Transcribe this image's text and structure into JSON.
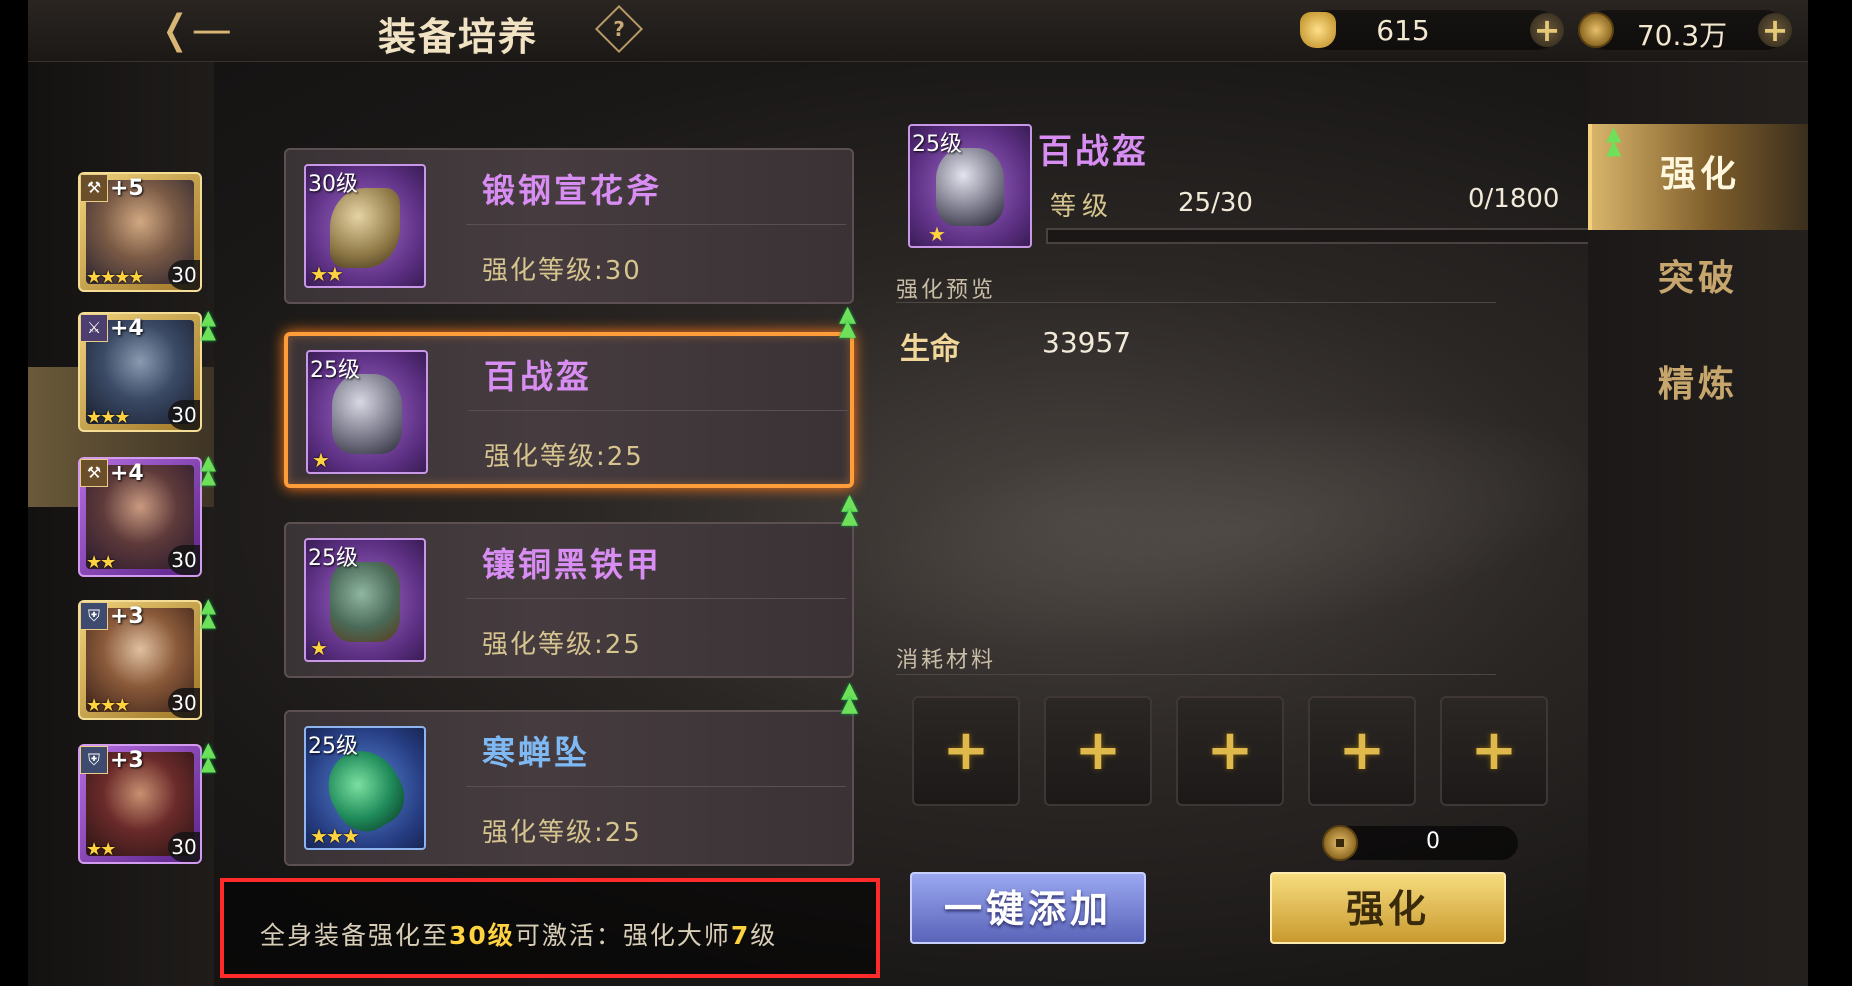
{
  "header": {
    "back_icon": "back-arrow-icon",
    "title": "装备培养",
    "help": "?",
    "currency_gold": {
      "icon": "gold-ingot-icon",
      "value": "615",
      "plus": "+"
    },
    "currency_coin": {
      "icon": "copper-coin-icon",
      "value": "70.3万",
      "plus": "+"
    }
  },
  "heroes": [
    {
      "plus": "+5",
      "stars": "★★★★",
      "level": "30",
      "frame": "gold",
      "role_icon": "axe-role-icon",
      "upgradable": false
    },
    {
      "plus": "+4",
      "stars": "★★★",
      "level": "30",
      "frame": "gold",
      "role_icon": "sword-role-icon",
      "upgradable": true,
      "selected": true
    },
    {
      "plus": "+4",
      "stars": "★★",
      "level": "30",
      "frame": "purple",
      "role_icon": "axe-role-icon",
      "upgradable": true
    },
    {
      "plus": "+3",
      "stars": "★★★",
      "level": "30",
      "frame": "gold",
      "role_icon": "shield-role-icon",
      "upgradable": true
    },
    {
      "plus": "+3",
      "stars": "★★",
      "level": "30",
      "frame": "purple",
      "role_icon": "shield-role-icon",
      "upgradable": true
    }
  ],
  "equipment": [
    {
      "badge": "30级",
      "name": "锻钢宣花斧",
      "stars": "★★",
      "enhance_label": "强化等级:30",
      "quality": "purple",
      "upgradable": false
    },
    {
      "badge": "25级",
      "name": "百战盔",
      "stars": "★",
      "enhance_label": "强化等级:25",
      "quality": "purple",
      "upgradable": true,
      "selected": true
    },
    {
      "badge": "25级",
      "name": "镶铜黑铁甲",
      "stars": "★",
      "enhance_label": "强化等级:25",
      "quality": "purple",
      "upgradable": true
    },
    {
      "badge": "25级",
      "name": "寒蝉坠",
      "stars": "★★★",
      "enhance_label": "强化等级:25",
      "quality": "blue",
      "upgradable": true
    }
  ],
  "hint": {
    "prefix": "全身装备强化至",
    "level": "30级",
    "middle": "可激活：强化大师",
    "master_level": "7",
    "suffix": "级"
  },
  "detail": {
    "badge": "25级",
    "stars": "★",
    "name": "百战盔",
    "level_label": "等级",
    "level_value": "25/30",
    "exp_value": "0/1800",
    "exp_progress": 0.0,
    "preview_title": "强化预览",
    "stat_name": "生命",
    "stat_value": "33957",
    "materials_title": "消耗材料",
    "material_slots": [
      "+",
      "+",
      "+",
      "+",
      "+"
    ],
    "cost_icon": "copper-coin-icon",
    "cost_value": "0",
    "auto_add_label": "一键添加",
    "enhance_label": "强化"
  },
  "tabs": [
    {
      "label": "强化",
      "active": true,
      "upgradable": true
    },
    {
      "label": "突破",
      "active": false,
      "upgradable": false
    },
    {
      "label": "精炼",
      "active": false,
      "upgradable": false
    }
  ],
  "colors": {
    "purple_quality": "#d88df2",
    "blue_quality": "#7fb9f3",
    "highlight": "#ffd23f",
    "selection": "#ff9d3a",
    "hint_border": "#ff2a2a"
  }
}
